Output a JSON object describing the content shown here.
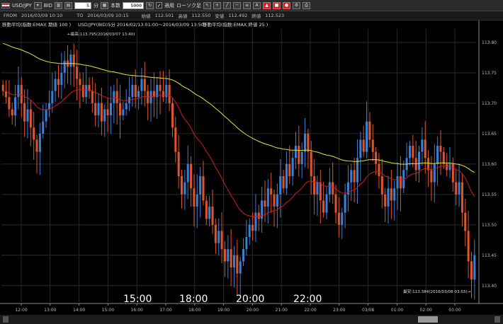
{
  "toolbar": {
    "symbol": "USD/JPY",
    "price_type": "BID",
    "interval_value": "5",
    "interval_unit": "分",
    "count_label": "本数",
    "count_value": "5000",
    "apply_label": "適用",
    "candle_label": "ローソク足",
    "tool_icons": [
      "cursor-icon",
      "crosshair-icon",
      "line-icon",
      "hline-icon",
      "fib-icon",
      "text-icon",
      "flag-red-icon",
      "stamp-red-icon",
      "circle-red-icon",
      "settings-icon",
      "print-icon"
    ]
  },
  "infobar": {
    "from_label": "FROM",
    "from_value": "2016/03/09 10:10",
    "to_label": "TO",
    "to_value": "2016/03/09 10:15",
    "open_label": "始値",
    "open_value": "112.501",
    "high_label": "高値",
    "high_value": "112.550",
    "low_label": "安値",
    "low_value": "112.492",
    "close_label": "終値",
    "close_value": "112.523"
  },
  "chart_header": {
    "ema_long_label": "移動平均(指数:EMA)( 期値 100 )",
    "pair_label": "USD/JPY(BID)5分 2016/02/13 01:00～2016/03/09 13:50)",
    "ema_short_label": "移動平均(指数:EMAX 終値 25 )"
  },
  "annotations": {
    "high": "←最高:113.795(2016/03/07 13:40)",
    "low": "最安:113.384(2016/03/08 03:55)→"
  },
  "overlay_times": [
    "15:00",
    "18:00",
    "20:00",
    "22:00"
  ],
  "colors": {
    "up": "#3c7fd6",
    "down": "#e0542a",
    "ema_long": "#e6e040",
    "ema_short": "#d21e1e",
    "grid": "#2a2a2a",
    "axis": "#888"
  },
  "chart_data": {
    "type": "candlestick",
    "y_ticks": [
      "113.80",
      "113.75",
      "113.70",
      "113.65",
      "113.60",
      "113.55",
      "113.50",
      "113.45",
      "113.40"
    ],
    "ylim": [
      113.373,
      113.822
    ],
    "x_ticks": [
      "12:00",
      "13:00",
      "14:00",
      "15:00",
      "16:00",
      "17:00",
      "18:00",
      "19:00",
      "20:00",
      "21:00",
      "22:00",
      "23:00",
      "03/08",
      "01:00",
      "02:00",
      "03:00"
    ],
    "closes": [
      113.72,
      113.71,
      113.69,
      113.68,
      113.71,
      113.73,
      113.7,
      113.67,
      113.69,
      113.66,
      113.64,
      113.62,
      113.65,
      113.67,
      113.69,
      113.7,
      113.72,
      113.74,
      113.73,
      113.75,
      113.77,
      113.76,
      113.78,
      113.76,
      113.74,
      113.73,
      113.71,
      113.73,
      113.72,
      113.7,
      113.68,
      113.7,
      113.67,
      113.69,
      113.68,
      113.7,
      113.72,
      113.7,
      113.68,
      113.69,
      113.7,
      113.71,
      113.73,
      113.71,
      113.72,
      113.74,
      113.72,
      113.7,
      113.72,
      113.71,
      113.73,
      113.72,
      113.71,
      113.73,
      113.7,
      113.66,
      113.62,
      113.58,
      113.55,
      113.57,
      113.6,
      113.56,
      113.53,
      113.55,
      113.58,
      113.54,
      113.51,
      113.53,
      113.5,
      113.47,
      113.49,
      113.46,
      113.44,
      113.46,
      113.43,
      113.45,
      113.42,
      113.44,
      113.46,
      113.48,
      113.5,
      113.49,
      113.52,
      113.51,
      113.54,
      113.53,
      113.56,
      113.55,
      113.53,
      113.55,
      113.58,
      113.56,
      113.6,
      113.58,
      113.61,
      113.63,
      113.6,
      113.62,
      113.65,
      113.62,
      113.58,
      113.55,
      113.57,
      113.54,
      113.52,
      113.55,
      113.57,
      113.55,
      113.52,
      113.5,
      113.52,
      113.55,
      113.57,
      113.59,
      113.57,
      113.61,
      113.64,
      113.62,
      113.67,
      113.64,
      113.62,
      113.6,
      113.58,
      113.55,
      113.53,
      113.56,
      113.54,
      113.56,
      113.58,
      113.56,
      113.59,
      113.61,
      113.63,
      113.61,
      113.59,
      113.62,
      113.64,
      113.61,
      113.59,
      113.57,
      113.6,
      113.63,
      113.62,
      113.6,
      113.59,
      113.6,
      113.57,
      113.55,
      113.57,
      113.52,
      113.49,
      113.44,
      113.41,
      113.45
    ]
  }
}
